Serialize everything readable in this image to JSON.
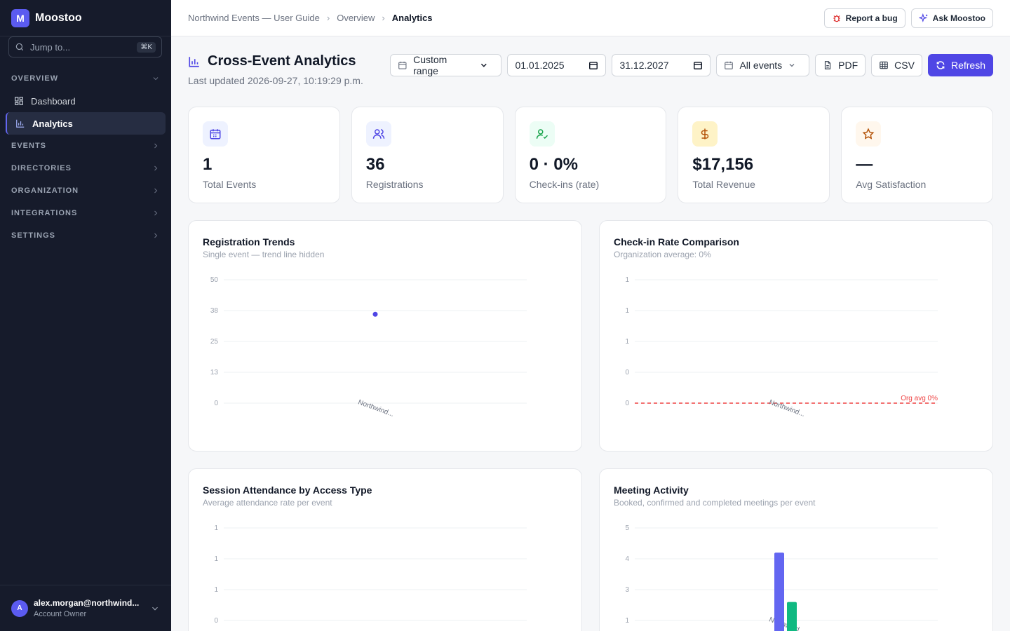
{
  "app": {
    "logo_letter": "M",
    "name": "Moostoo"
  },
  "sidebar": {
    "search_placeholder": "Jump to...",
    "search_shortcut": "⌘K",
    "sections": [
      {
        "label": "OVERVIEW",
        "items": [
          {
            "label": "Dashboard",
            "icon": "grid-icon"
          },
          {
            "label": "Analytics",
            "icon": "bar-chart-icon",
            "active": true
          }
        ]
      },
      {
        "label": "EVENTS"
      },
      {
        "label": "DIRECTORIES"
      },
      {
        "label": "ORGANIZATION"
      },
      {
        "label": "INTEGRATIONS"
      },
      {
        "label": "SETTINGS"
      }
    ],
    "user": {
      "initial": "A",
      "email": "alex.morgan@northwind...",
      "role": "Account Owner"
    }
  },
  "topbar": {
    "breadcrumb": [
      "Northwind Events — User Guide",
      "Overview",
      "Analytics"
    ],
    "report_bug": "Report a bug",
    "ask": "Ask Moostoo"
  },
  "page": {
    "title": "Cross-Event Analytics",
    "updated": "Last updated 2026-09-27, 10:19:29 p.m.",
    "filters": {
      "range": "Custom range",
      "from": "01.01.2025",
      "to": "31.12.2027",
      "events": "All events",
      "pdf": "PDF",
      "csv": "CSV",
      "refresh": "Refresh"
    }
  },
  "kpis": [
    {
      "value": "1",
      "label": "Total Events",
      "icon": "calendar-icon",
      "color": "#4f46e5",
      "bg": "#eef2ff"
    },
    {
      "value": "36",
      "label": "Registrations",
      "icon": "users-icon",
      "color": "#4f46e5",
      "bg": "#eef2ff"
    },
    {
      "value": "0 · 0%",
      "label": "Check-ins (rate)",
      "icon": "user-check-icon",
      "color": "#16a34a",
      "bg": "#ecfdf5"
    },
    {
      "value": "$17,156",
      "label": "Total Revenue",
      "icon": "dollar-icon",
      "color": "#b45309",
      "bg": "#fef3c7"
    },
    {
      "value": "—",
      "label": "Avg Satisfaction",
      "icon": "star-icon",
      "color": "#b45309",
      "bg": "#fff7ed"
    }
  ],
  "charts": [
    {
      "title": "Registration Trends",
      "subtitle": "Single event — trend line hidden"
    },
    {
      "title": "Check-in Rate Comparison",
      "subtitle": "Organization average: 0%"
    },
    {
      "title": "Session Attendance by Access Type",
      "subtitle": "Average attendance rate per event"
    },
    {
      "title": "Meeting Activity",
      "subtitle": "Booked, confirmed and completed meetings per event"
    }
  ],
  "chart_data": [
    {
      "type": "scatter",
      "ticks": [
        "50",
        "38",
        "25",
        "13",
        "0"
      ],
      "ylim": [
        0,
        50
      ],
      "categories": [
        "Northwind..."
      ],
      "series": [
        {
          "values": [
            36
          ],
          "color": "#4f46e5"
        }
      ]
    },
    {
      "type": "line",
      "ticks": [
        "1",
        "1",
        "1",
        "0",
        "0"
      ],
      "ylim": [
        0,
        1
      ],
      "categories": [
        "Northwind..."
      ],
      "reference": {
        "label": "Org avg 0%",
        "value": 0,
        "color": "#ef4444"
      }
    },
    {
      "type": "bar",
      "ticks": [
        "1",
        "1",
        "1",
        "0"
      ],
      "ylim": [
        0,
        1
      ],
      "categories": []
    },
    {
      "type": "bar",
      "ticks": [
        "5",
        "4",
        "3",
        "1"
      ],
      "categories": [
        "Northwind..."
      ],
      "series": [
        {
          "values": [
            4.2
          ],
          "color": "#6366f1"
        },
        {
          "values": [
            2.6
          ],
          "color": "#10b981"
        }
      ]
    }
  ]
}
